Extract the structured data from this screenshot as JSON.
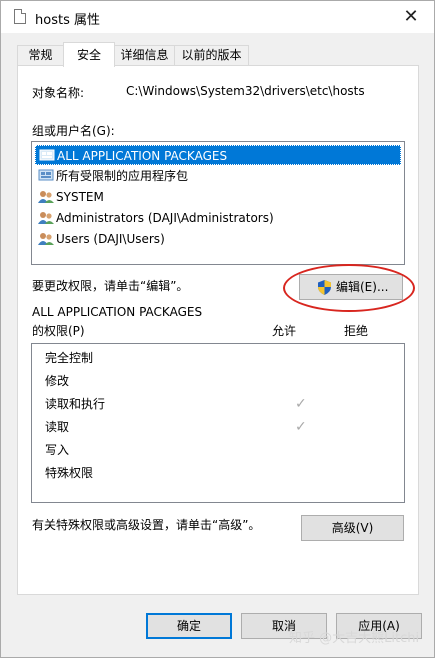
{
  "window": {
    "title": "hosts 属性",
    "close_glyph": "✕",
    "file_icon": "file-icon"
  },
  "tabs": [
    {
      "label": "常规",
      "active": false
    },
    {
      "label": "安全",
      "active": true
    },
    {
      "label": "详细信息",
      "active": false
    },
    {
      "label": "以前的版本",
      "active": false
    }
  ],
  "object": {
    "label": "对象名称:",
    "value": "C:\\Windows\\System32\\drivers\\etc\\hosts"
  },
  "groups": {
    "label": "组或用户名(G):",
    "items": [
      {
        "label": "ALL APPLICATION PACKAGES",
        "icon": "app-package-icon",
        "selected": true
      },
      {
        "label": "所有受限制的应用程序包",
        "icon": "app-package-icon",
        "selected": false
      },
      {
        "label": "SYSTEM",
        "icon": "users-icon",
        "selected": false
      },
      {
        "label": "Administrators (DAJI\\Administrators)",
        "icon": "users-icon",
        "selected": false
      },
      {
        "label": "Users (DAJI\\Users)",
        "icon": "users-icon",
        "selected": false
      }
    ]
  },
  "change_hint": "要更改权限，请单击“编辑”。",
  "edit_button": {
    "label": "编辑(E)...",
    "icon": "uac-shield-icon"
  },
  "permissions": {
    "subject": "ALL APPLICATION PACKAGES",
    "label": "的权限(P)",
    "allow_header": "允许",
    "deny_header": "拒绝",
    "rows": [
      {
        "label": "完全控制",
        "allow": false
      },
      {
        "label": "修改",
        "allow": false
      },
      {
        "label": "读取和执行",
        "allow": true
      },
      {
        "label": "读取",
        "allow": true
      },
      {
        "label": "写入",
        "allow": false
      },
      {
        "label": "特殊权限",
        "allow": false
      }
    ],
    "check_glyph": "✓"
  },
  "advanced_hint": "有关特殊权限或高级设置，请单击“高级”。",
  "advanced_button": "高级(V)",
  "footer": {
    "ok": "确定",
    "cancel": "取消",
    "apply": "应用(A)"
  },
  "watermark": "知乎 @大吉大熊Litchi",
  "colors": {
    "selection": "#0078d7",
    "highlight_oval": "#d8261f"
  }
}
